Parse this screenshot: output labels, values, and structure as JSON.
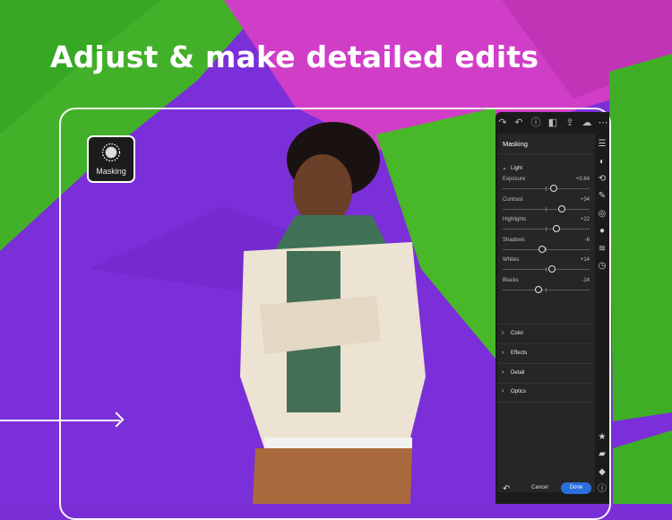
{
  "headline": "Adjust & make detailed edits",
  "masking_badge": {
    "label": "Masking",
    "icon": "masking-icon"
  },
  "panel": {
    "toolbar_icons": [
      "redo-icon",
      "undo-icon",
      "help-icon",
      "compare-icon",
      "share-icon",
      "cloud-icon",
      "more-icon"
    ],
    "rail_icons": [
      "edit-sliders-icon",
      "presets-icon",
      "crop-icon",
      "healing-brush-icon",
      "masking-icon",
      "color-drop-icon",
      "versions-icon",
      "history-icon"
    ],
    "rail_bottom_icons": [
      "star-icon",
      "comment-icon",
      "tag-icon",
      "info-icon"
    ],
    "title": "Masking",
    "light_section": "Light",
    "sliders": [
      {
        "name": "Exposure",
        "value": "+0.64",
        "pos": 0.59
      },
      {
        "name": "Contrast",
        "value": "+34",
        "pos": 0.68
      },
      {
        "name": "Highlights",
        "value": "+22",
        "pos": 0.62
      },
      {
        "name": "Shadows",
        "value": "-6",
        "pos": 0.45
      },
      {
        "name": "Whites",
        "value": "+14",
        "pos": 0.57
      },
      {
        "name": "Blacks",
        "value": "-14",
        "pos": 0.41
      }
    ],
    "sections": [
      "Color",
      "Effects",
      "Detail",
      "Optics"
    ],
    "cancel_label": "Cancel",
    "done_label": "Done",
    "accent_color": "#2a6fdb"
  }
}
